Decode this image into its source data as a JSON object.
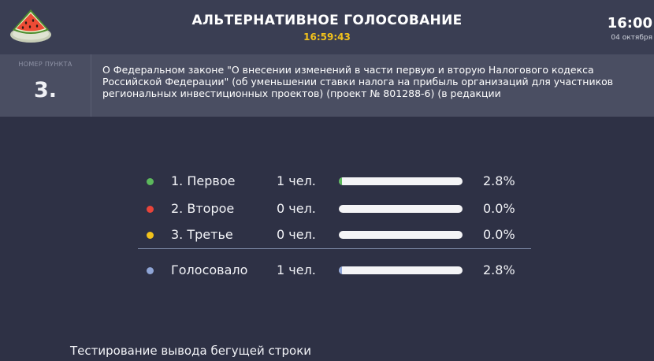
{
  "header": {
    "title": "АЛЬТЕРНАТИВНОЕ ГОЛОСОВАНИЕ",
    "timer": "16:59:43",
    "clock": "16:00",
    "date": "04 октября",
    "logo_icon": "watermelon-slice-icon"
  },
  "item": {
    "number_label": "НОМЕР ПУНКТА",
    "number": "3.",
    "text": "О Федеральном законе \"О внесении изменений в части первую и вторую Налогового кодекса Российской Федерации\" (об уменьшении ставки налога на прибыль организаций для участников региональных инвестиционных проектов) (проект № 801288-6) (в редакции"
  },
  "results": {
    "options": [
      {
        "label": "1. Первое",
        "count": "1 чел.",
        "percent": "2.8%",
        "fill": 0.028,
        "color": "#5cb85c"
      },
      {
        "label": "2. Второе",
        "count": "0 чел.",
        "percent": "0.0%",
        "fill": 0.0,
        "color": "#e8443a"
      },
      {
        "label": "3. Третье",
        "count": "0 чел.",
        "percent": "0.0%",
        "fill": 0.0,
        "color": "#f2c21b"
      }
    ],
    "total": {
      "label": "Голосовало",
      "count": "1 чел.",
      "percent": "2.8%",
      "fill": 0.028,
      "color": "#8fa5d6"
    }
  },
  "ticker": {
    "text": "Тестирование вывода бегущей строки"
  }
}
